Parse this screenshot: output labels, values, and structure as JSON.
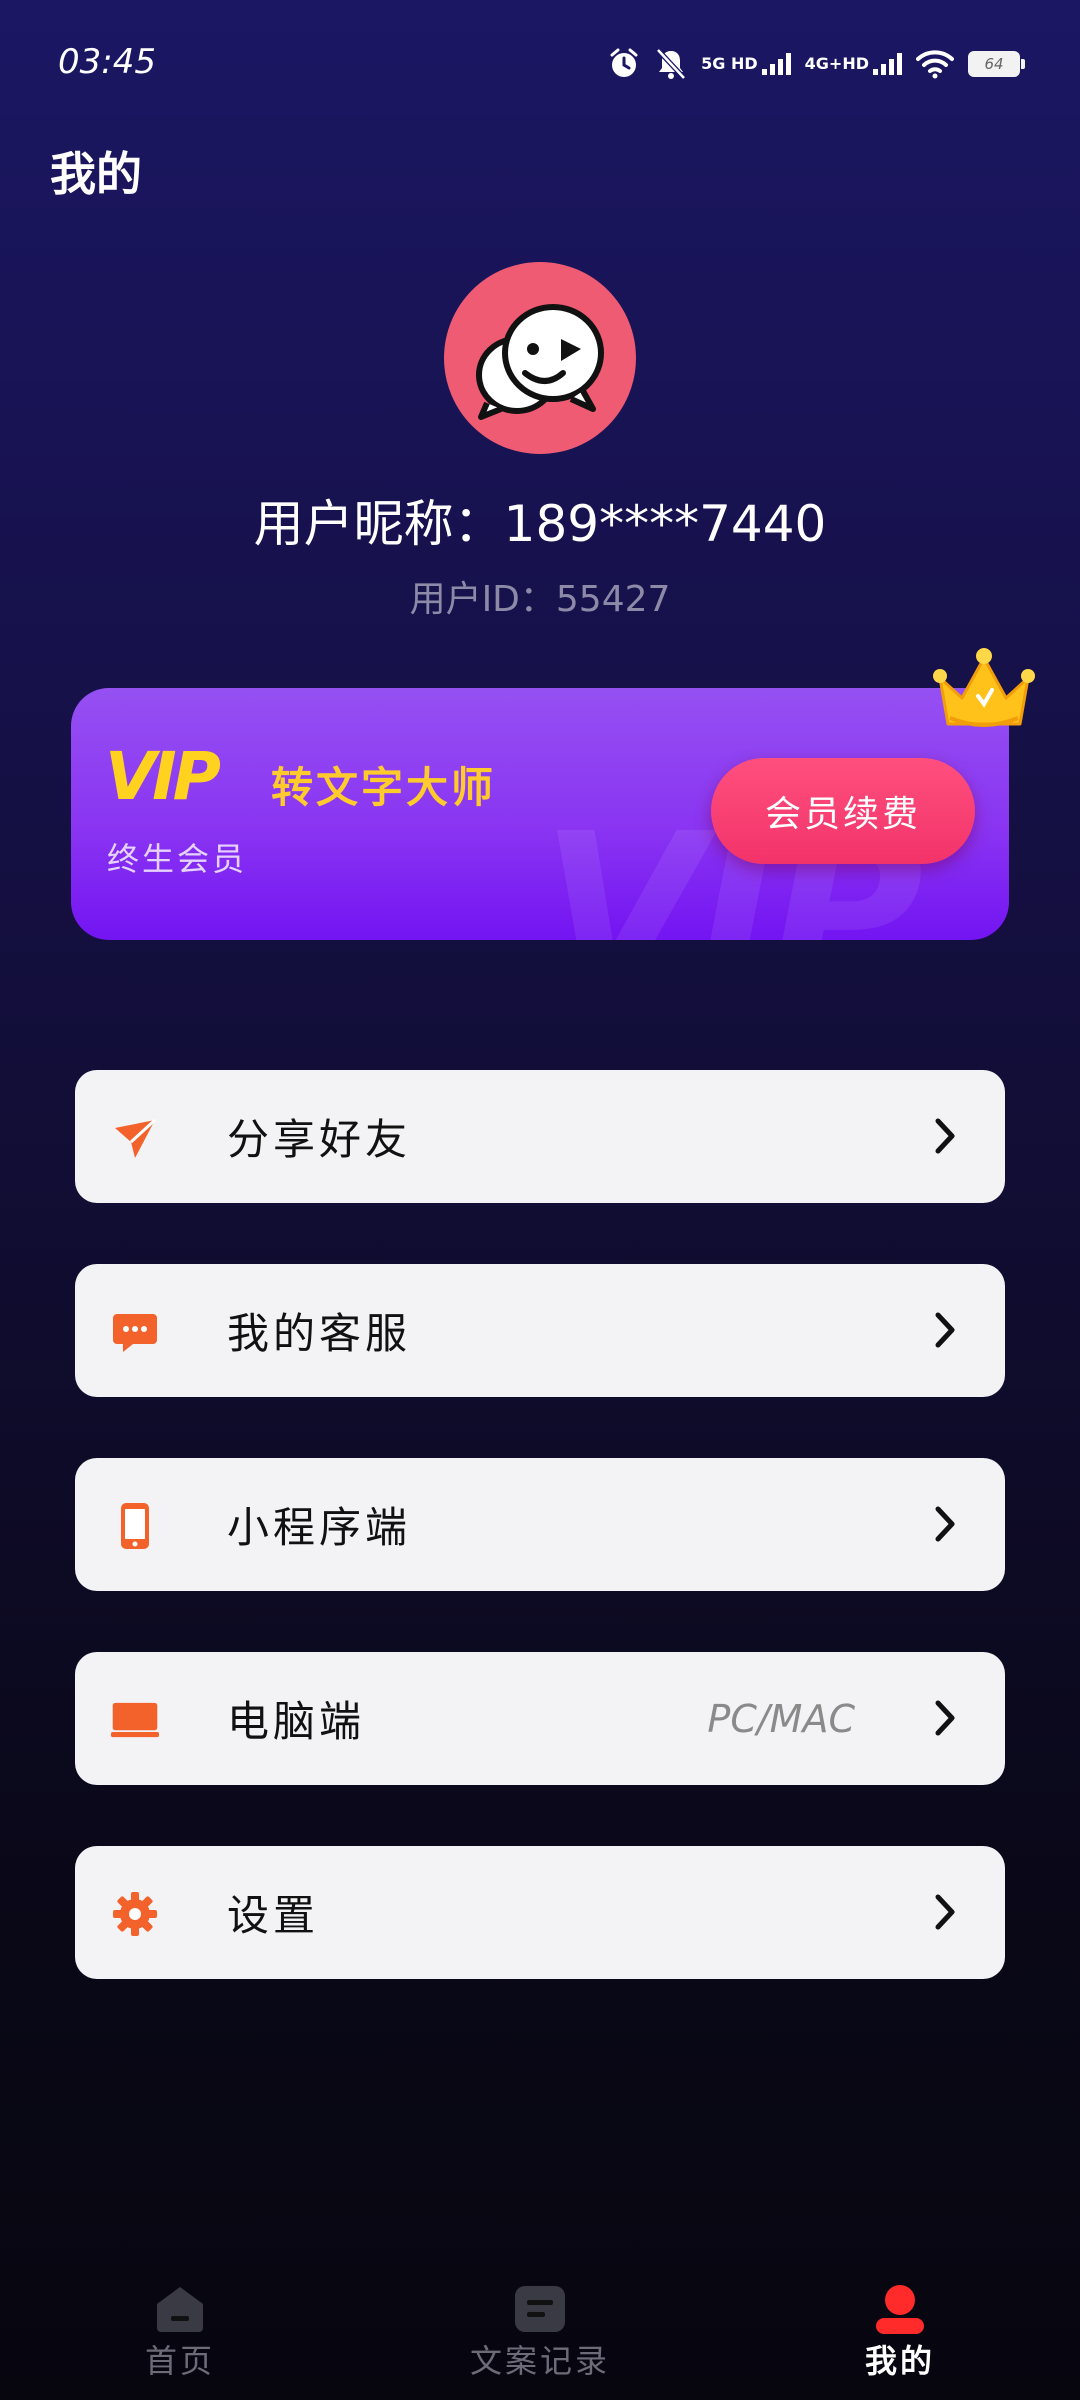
{
  "status_bar": {
    "time": "03:45",
    "network1": "5G HD",
    "network2": "4G+HD",
    "battery": "64",
    "icons": [
      "alarm-icon",
      "mute-icon",
      "signal-icon",
      "signal-icon",
      "wifi-icon",
      "battery-icon"
    ]
  },
  "page": {
    "title": "我的"
  },
  "profile": {
    "nickname_label": "用户昵称：",
    "nickname": "189****7440",
    "user_id_label": "用户ID：",
    "user_id": "55427"
  },
  "vip": {
    "logo": "VIP",
    "app_name": "转文字大师",
    "status": "终生会员",
    "renew_label": "会员续费",
    "watermark": "VIP"
  },
  "menu": [
    {
      "label": "分享好友",
      "icon": "share-plane-icon",
      "sub": ""
    },
    {
      "label": "我的客服",
      "icon": "chat-bubble-icon",
      "sub": ""
    },
    {
      "label": "小程序端",
      "icon": "phone-icon",
      "sub": ""
    },
    {
      "label": "电脑端",
      "icon": "laptop-icon",
      "sub": "PC/MAC"
    },
    {
      "label": "设置",
      "icon": "gear-icon",
      "sub": ""
    }
  ],
  "bottom_nav": [
    {
      "label": "首页",
      "icon": "home-icon",
      "active": false
    },
    {
      "label": "文案记录",
      "icon": "document-icon",
      "active": false
    },
    {
      "label": "我的",
      "icon": "user-icon",
      "active": true
    }
  ],
  "colors": {
    "accent_orange": "#f4622c",
    "vip_gold": "#ffd21f",
    "renew_pink": "#f2336a",
    "active_nav": "#ff2a2a"
  }
}
